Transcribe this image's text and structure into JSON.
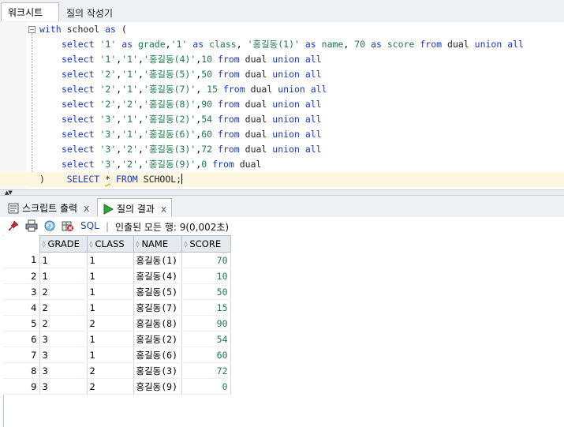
{
  "tabs": {
    "worksheet": "워크시트",
    "query_builder": "질의 작성기"
  },
  "editor": {
    "line1": {
      "kw1": "with",
      "t1": " school ",
      "kw2": "as",
      "t2": " ("
    },
    "line2": {
      "kw1": "select",
      "s1": "'1'",
      "kw2": "as",
      "c1": "grade",
      "s2": "'1'",
      "kw3": "as",
      "c2": "class",
      "s3": "'홍길동(1)'",
      "kw4": "as",
      "c3": "name",
      "n1": "70",
      "kw5": "as",
      "c4": "score",
      "kw6": "from",
      "t1": "dual",
      "kw7": "union all"
    },
    "rows": [
      {
        "select": "select",
        "a": "'1'",
        "b": "'1'",
        "c": "'홍길동(4)'",
        "d": "10",
        "from": "from",
        "dual": "dual",
        "union": "union all"
      },
      {
        "select": "select",
        "a": "'2'",
        "b": "'1'",
        "c": "'홍길동(5)'",
        "d": "50",
        "from": "from",
        "dual": "dual",
        "union": "union all"
      },
      {
        "select": "select",
        "a": "'2'",
        "b": "'1'",
        "c": "'홍길동(7)'",
        "d": " 15",
        "from": "from",
        "dual": "dual",
        "union": "union all"
      },
      {
        "select": "select",
        "a": "'2'",
        "b": "'2'",
        "c": "'홍길동(8)'",
        "d": "90",
        "from": "from",
        "dual": "dual",
        "union": "union all"
      },
      {
        "select": "select",
        "a": "'3'",
        "b": "'1'",
        "c": "'홍길동(2)'",
        "d": "54",
        "from": "from",
        "dual": "dual",
        "union": "union all"
      },
      {
        "select": "select",
        "a": "'3'",
        "b": "'1'",
        "c": "'홍길동(6)'",
        "d": "60",
        "from": "from",
        "dual": "dual",
        "union": "union all"
      },
      {
        "select": "select",
        "a": "'3'",
        "b": "'2'",
        "c": "'홍길동(3)'",
        "d": "72",
        "from": "from",
        "dual": "dual",
        "union": "union all"
      },
      {
        "select": "select",
        "a": "'3'",
        "b": "'2'",
        "c": "'홍길동(9)'",
        "d": "0",
        "from": "from",
        "dual": "dual",
        "union": ""
      }
    ],
    "last": {
      "paren": ")",
      "kw1": "SELECT",
      "star": "*",
      "kw2": "FROM",
      "t1": "SCHOOL;"
    }
  },
  "lower_tabs": {
    "script_output": "스크립트 출력",
    "query_result": "질의 결과",
    "close": "x"
  },
  "toolbar": {
    "sql_label": "SQL",
    "separator": "|",
    "status": "인출된 모든 행: 9(0,002초)"
  },
  "grid": {
    "columns": [
      "GRADE",
      "CLASS",
      "NAME",
      "SCORE"
    ],
    "rows": [
      {
        "n": "1",
        "grade": "1",
        "class": "1",
        "name": "홍길동(1)",
        "score": "70"
      },
      {
        "n": "2",
        "grade": "1",
        "class": "1",
        "name": "홍길동(4)",
        "score": "10"
      },
      {
        "n": "3",
        "grade": "2",
        "class": "1",
        "name": "홍길동(5)",
        "score": "50"
      },
      {
        "n": "4",
        "grade": "2",
        "class": "1",
        "name": "홍길동(7)",
        "score": "15"
      },
      {
        "n": "5",
        "grade": "2",
        "class": "2",
        "name": "홍길동(8)",
        "score": "90"
      },
      {
        "n": "6",
        "grade": "3",
        "class": "1",
        "name": "홍길동(2)",
        "score": "54"
      },
      {
        "n": "7",
        "grade": "3",
        "class": "1",
        "name": "홍길동(6)",
        "score": "60"
      },
      {
        "n": "8",
        "grade": "3",
        "class": "2",
        "name": "홍길동(3)",
        "score": "72"
      },
      {
        "n": "9",
        "grade": "3",
        "class": "2",
        "name": "홍길동(9)",
        "score": "0"
      }
    ]
  },
  "colors": {
    "keyword": "#1a36c2",
    "string": "#1d7a49",
    "current_line": "#fdf7e0"
  }
}
